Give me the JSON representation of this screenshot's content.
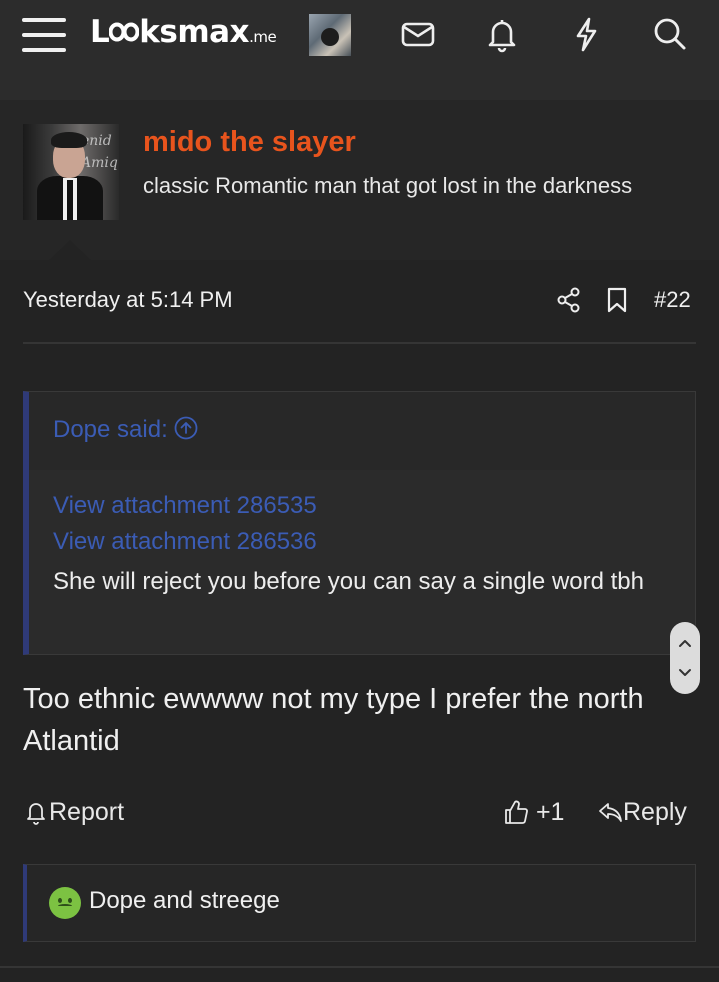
{
  "header": {
    "logo_text": "Looksmax",
    "logo_tld": ".me",
    "icons": [
      "menu-icon",
      "envelope-icon",
      "bell-icon",
      "lightning-icon",
      "search-icon"
    ]
  },
  "author": {
    "name": "mido the slayer",
    "title": "classic Romantic man that got lost in the darkness",
    "name_color": "#e8541d"
  },
  "post": {
    "timestamp": "Yesterday at 5:14 PM",
    "number": "#22",
    "quote": {
      "author_label": "Dope said:",
      "links": [
        "View attachment 286535",
        "View attachment 286536"
      ],
      "text": "She will reject you before you can say a single word tbh"
    },
    "body": "Too ethnic ewwww not my type I prefer the north Atlantid",
    "actions": {
      "report": "Report",
      "like_count": "+1",
      "reply": "Reply"
    },
    "reactions_text": "Dope and streege"
  },
  "colors": {
    "background": "#232323",
    "link": "#3b5cb5",
    "quote_border": "#2f3a78"
  }
}
